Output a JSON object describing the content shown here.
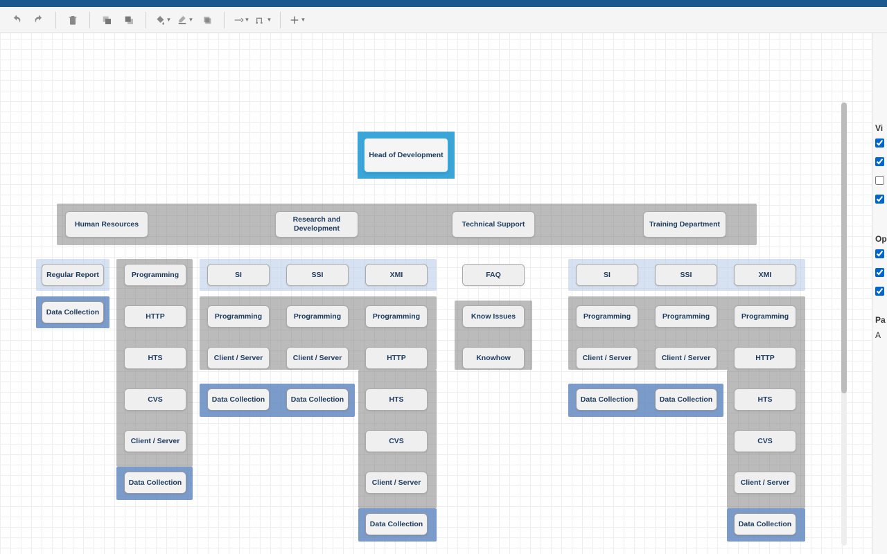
{
  "toolbar": {
    "undo": "undo",
    "redo": "redo",
    "delete": "delete",
    "tofront": "to-front",
    "toback": "to-back",
    "fill": "fill",
    "stroke": "stroke",
    "shadow": "shadow",
    "conn": "connection",
    "route": "routing",
    "add": "add"
  },
  "nodes": {
    "root": "Head of Development",
    "hr": "Human Resources",
    "rnd": "Research and Development",
    "tech": "Technical Support",
    "train": "Training Department",
    "regreport": "Regular Report",
    "datacol": "Data Collection",
    "prog": "Programming",
    "http": "HTTP",
    "hts": "HTS",
    "cvs": "CVS",
    "clientserver": "Client / Server",
    "si": "SI",
    "ssi": "SSI",
    "xmi": "XMI",
    "faq": "FAQ",
    "knowissues": "Know Issues",
    "knowhow": "Knowhow"
  },
  "side": {
    "view": "Vi",
    "op": "Op",
    "pa": "Pa",
    "a": "A"
  }
}
